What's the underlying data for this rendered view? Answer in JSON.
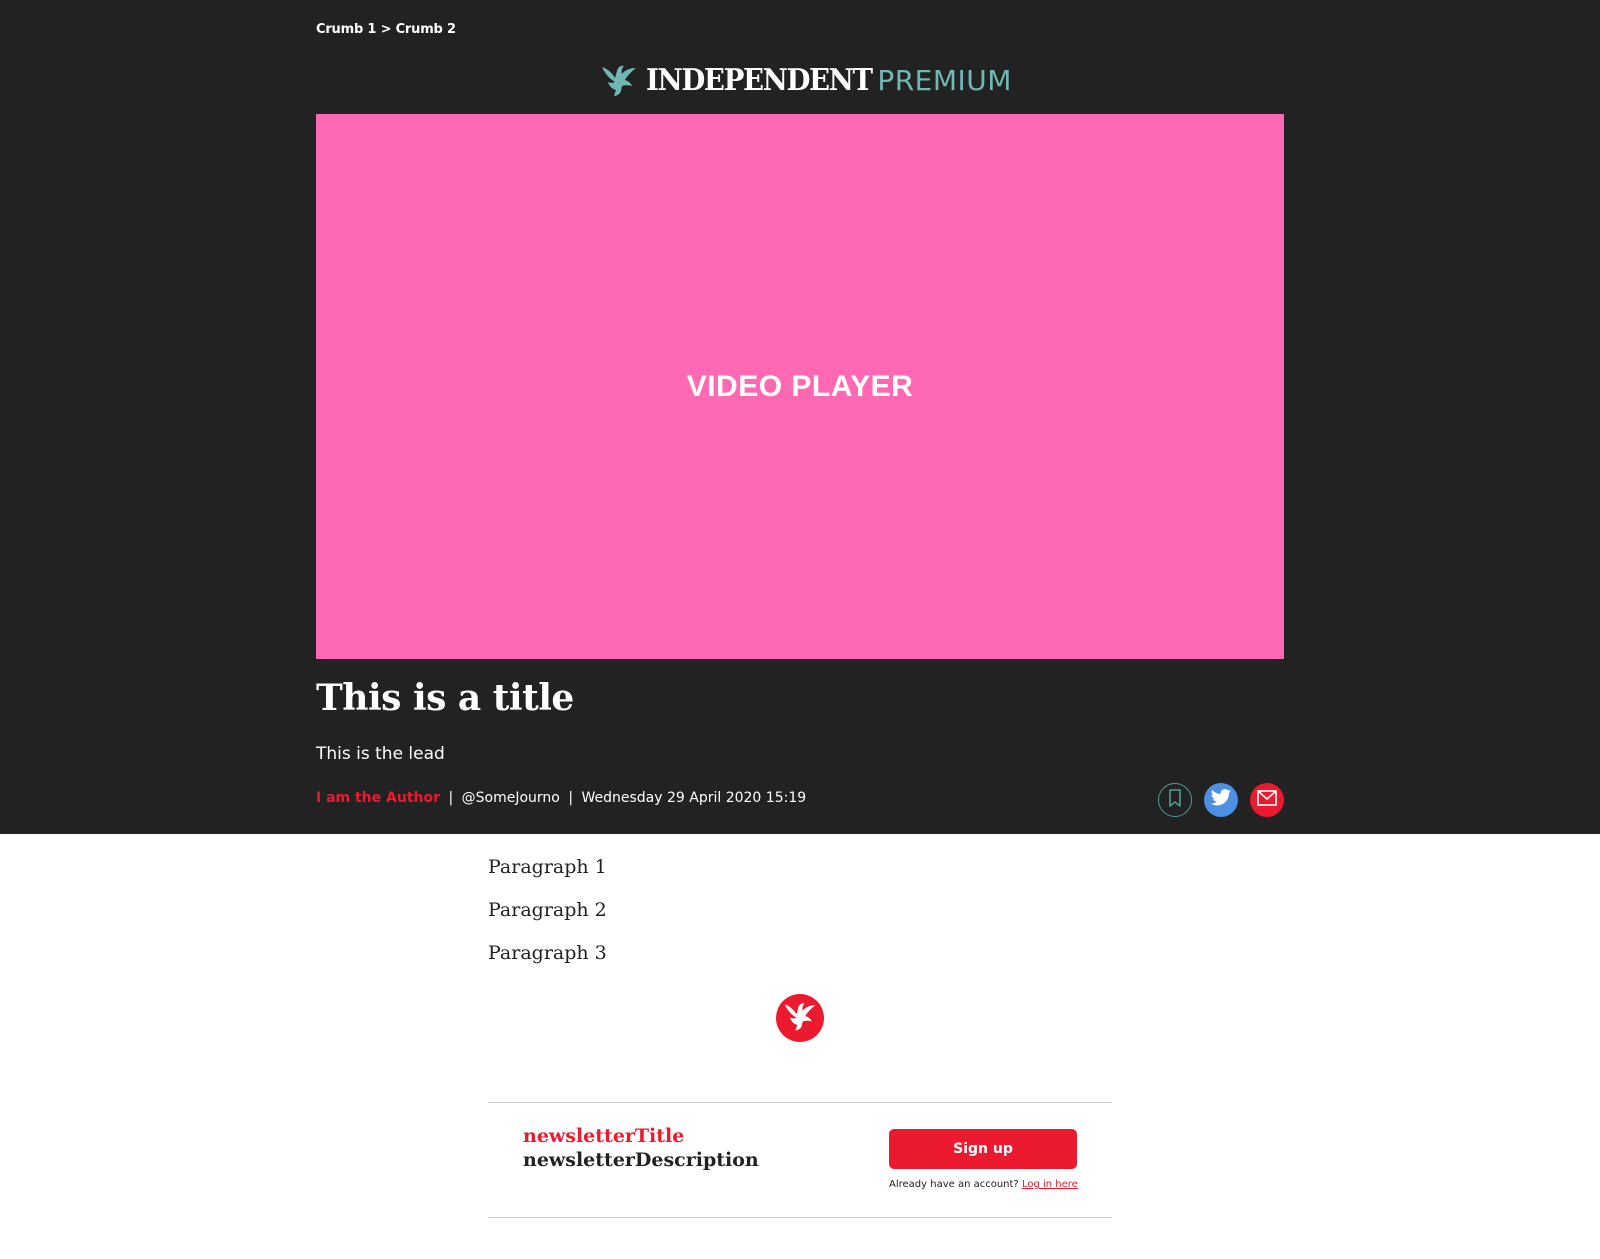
{
  "breadcrumb": {
    "crumbs": [
      "Crumb 1",
      "Crumb 2"
    ],
    "separator": ">"
  },
  "brand": {
    "name": "INDEPENDENT",
    "tier": "PREMIUM",
    "logo_icon": "eagle-icon",
    "colors": {
      "premium": "#6fb8b3",
      "accent": "#ec1a2e",
      "hero_bg": "#222222"
    }
  },
  "video": {
    "label": "VIDEO PLAYER",
    "background": "#ff69b4"
  },
  "article": {
    "title": "This is a title",
    "lead": "This is the lead",
    "author": "I am the Author",
    "handle": "@SomeJourno",
    "date": "Wednesday 29 April 2020 15:19",
    "byline_separator": "|",
    "paragraphs": [
      "Paragraph 1",
      "Paragraph 2",
      "Paragraph 3"
    ]
  },
  "share": {
    "buttons": [
      {
        "name": "bookmark",
        "icon": "bookmark-icon",
        "color": "#4a9e98"
      },
      {
        "name": "twitter",
        "icon": "twitter-icon",
        "color": "#4b90e2"
      },
      {
        "name": "email",
        "icon": "email-icon",
        "color": "#ec1a2e"
      }
    ]
  },
  "newsletter": {
    "title": "newsletterTitle",
    "description": "newsletterDescription",
    "signup_label": "Sign up",
    "login_prompt": "Already have an account?",
    "login_link": "Log in here"
  }
}
